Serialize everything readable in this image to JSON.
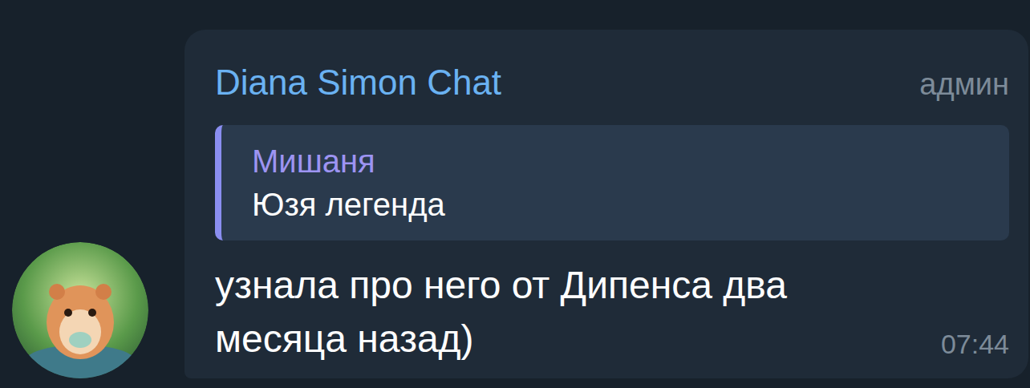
{
  "message": {
    "sender": "Diana Simon Chat",
    "role": "админ",
    "reply": {
      "author": "Мишаня",
      "text": "Юзя легенда"
    },
    "text": "узнала про него от Дипенса два месяца назад)",
    "time": "07:44"
  }
}
